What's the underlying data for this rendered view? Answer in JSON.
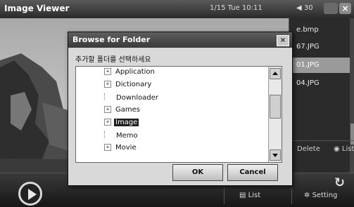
{
  "app": {
    "title": "Image Viewer",
    "datetime": "1/15 Tue 10:11",
    "volume": "◀ 30",
    "close_glyph": "×"
  },
  "file_list": {
    "items": [
      {
        "name": "e.bmp",
        "selected": false
      },
      {
        "name": "67.JPG",
        "selected": false
      },
      {
        "name": "01.JPG",
        "selected": true
      },
      {
        "name": "04.JPG",
        "selected": false
      }
    ]
  },
  "side_actions": {
    "delete_label": "Delete",
    "list_label": "List"
  },
  "bottom_bar": {
    "list_label": "List",
    "setting_label": "Setting"
  },
  "dialog": {
    "title": "Browse for Folder",
    "close_glyph": "×",
    "instruction": "추가할 폴더를 선택하세요",
    "tree": [
      {
        "label": "Application",
        "expander": "+",
        "selected": false
      },
      {
        "label": "Dictionary",
        "expander": "+",
        "selected": false
      },
      {
        "label": "Downloader",
        "expander": "",
        "selected": false
      },
      {
        "label": "Games",
        "expander": "+",
        "selected": false
      },
      {
        "label": "Image",
        "expander": "+",
        "selected": true
      },
      {
        "label": "Memo",
        "expander": "",
        "selected": false
      },
      {
        "label": "Movie",
        "expander": "+",
        "selected": false
      }
    ],
    "ok_label": "OK",
    "cancel_label": "Cancel"
  },
  "icons": {
    "play": "play-icon",
    "refresh": "refresh-icon",
    "list": "list-icon",
    "setting": "gear-icon"
  }
}
